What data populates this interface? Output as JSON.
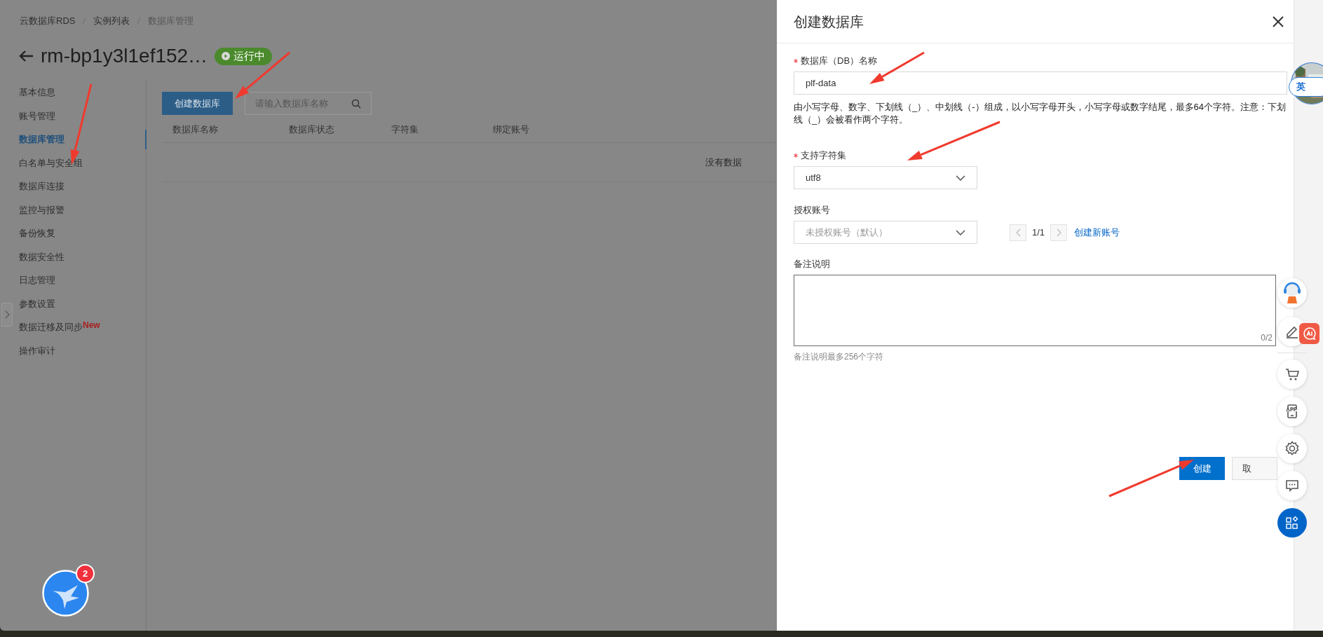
{
  "breadcrumb": [
    {
      "label": "云数据库RDS"
    },
    {
      "label": "实例列表"
    },
    {
      "label": "数据库管理"
    }
  ],
  "instance": {
    "title": "rm-bp1y3l1ef152…",
    "status": "运行中"
  },
  "sidebar": {
    "items": [
      {
        "label": "基本信息",
        "selected": false
      },
      {
        "label": "账号管理",
        "selected": false
      },
      {
        "label": "数据库管理",
        "selected": true
      },
      {
        "label": "白名单与安全组",
        "selected": false
      },
      {
        "label": "数据库连接",
        "selected": false
      },
      {
        "label": "监控与报警",
        "selected": false
      },
      {
        "label": "备份恢复",
        "selected": false
      },
      {
        "label": "数据安全性",
        "selected": false
      },
      {
        "label": "日志管理",
        "selected": false
      },
      {
        "label": "参数设置",
        "selected": false
      },
      {
        "label": "数据迁移及同步",
        "selected": false,
        "badge": "New"
      },
      {
        "label": "操作审计",
        "selected": false
      }
    ]
  },
  "toolbar": {
    "create_button": "创建数据库",
    "search": {
      "placeholder": "请输入数据库名称"
    }
  },
  "table": {
    "columns": [
      "数据库名称",
      "数据库状态",
      "字符集",
      "绑定账号"
    ],
    "empty_text": "没有数据"
  },
  "drawer": {
    "title": "创建数据库",
    "fields": [
      {
        "kind": "text",
        "label": "数据库（DB）名称",
        "required": true,
        "value": "plf-data",
        "help": "由小写字母、数字、下划线（_）、中划线（-）组成，以小写字母开头，小写字母或数字结尾，最多64个字符。注意：下划线（_）会被看作两个字符。"
      },
      {
        "kind": "select",
        "label": "支持字符集",
        "required": true,
        "value": "utf8"
      },
      {
        "kind": "select_pager",
        "label": "授权账号",
        "required": false,
        "placeholder": "未授权账号（默认）",
        "page": "1/1",
        "link": "创建新账号"
      },
      {
        "kind": "textarea",
        "label": "备注说明",
        "required": false,
        "counter": "0/2",
        "help": "备注说明最多256个字符"
      }
    ],
    "buttons": [
      {
        "label": "创建",
        "kind": "primary"
      },
      {
        "label": "取",
        "kind": "default"
      }
    ]
  },
  "ime_indicator": "英",
  "notification_badge": "2"
}
